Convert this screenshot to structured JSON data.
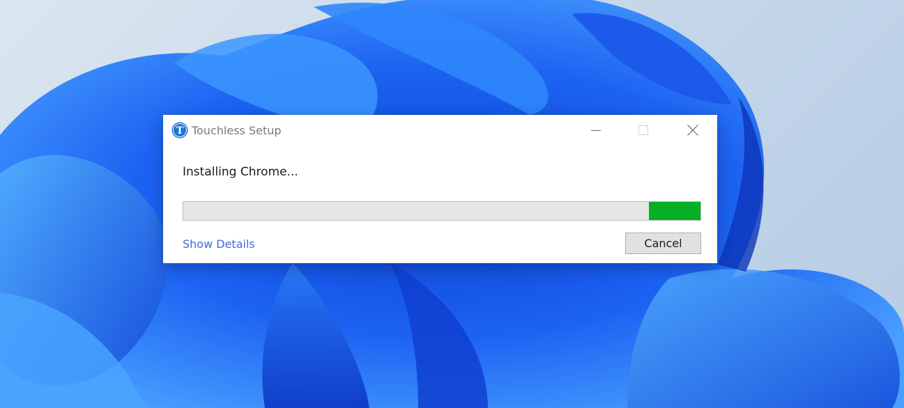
{
  "window": {
    "title": "Touchless Setup",
    "app_icon_letter": "T",
    "app_icon_color": "#1a73d9"
  },
  "installer": {
    "status": "Installing Chrome...",
    "progress_fraction": 0.1,
    "progress_color": "#06b025",
    "show_details_label": "Show Details",
    "cancel_label": "Cancel"
  },
  "colors": {
    "link": "#3f6ad8",
    "wallpaper_primary": "#1f5bf0"
  }
}
